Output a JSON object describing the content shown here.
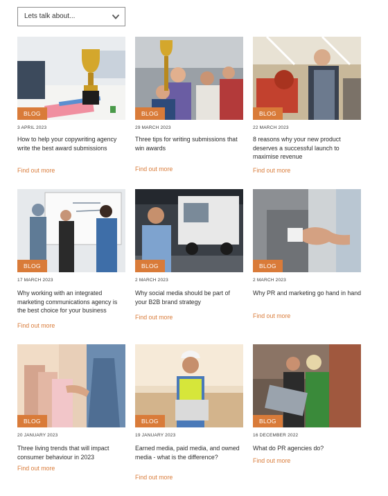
{
  "filter": {
    "label": "Lets talk about..."
  },
  "posts": [
    {
      "badge": "BLOG",
      "date": "3 APRIL 2023",
      "title": "How to help your copywriting agency write the best award submissions",
      "link": "Find out more",
      "image": "trophy-on-desk"
    },
    {
      "badge": "BLOG",
      "date": "29 MARCH 2023",
      "title": "Three tips for writing submissions that win awards",
      "link": "Find out more",
      "image": "team-celebrating-trophy"
    },
    {
      "badge": "BLOG",
      "date": "22 MARCH 2023",
      "title": "8 reasons why your new product deserves a successful launch to maximise revenue",
      "link": "Find out more",
      "image": "engineer-with-robot"
    },
    {
      "badge": "BLOG",
      "date": "17 MARCH 2023",
      "title": "Why working with an integrated marketing communications agency is the best choice for your business",
      "link": "Find out more",
      "image": "team-at-whiteboard"
    },
    {
      "badge": "BLOG",
      "date": "2 MARCH 2023",
      "title": "Why social media should be part of your B2B brand strategy",
      "link": "Find out more",
      "image": "man-with-trucks"
    },
    {
      "badge": "BLOG",
      "date": "2 MARCH 2023",
      "title": "Why PR and marketing go hand in hand",
      "link": "Find out more",
      "image": "handshake"
    },
    {
      "badge": "BLOG",
      "date": "20 JANUARY 2023",
      "title": "Three living trends that will impact consumer behaviour in 2023",
      "link": "Find out more",
      "image": "clothes-rail"
    },
    {
      "badge": "BLOG",
      "date": "19 JANUARY 2023",
      "title": "Earned media, paid media, and owned media - what is the difference?",
      "link": "Find out more",
      "image": "worker-with-laptop"
    },
    {
      "badge": "BLOG",
      "date": "16 DECEMBER 2022",
      "title": "What do PR agencies do?",
      "link": "Find out more",
      "image": "colleagues-with-laptop"
    }
  ]
}
